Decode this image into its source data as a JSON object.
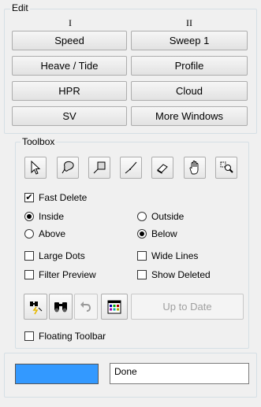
{
  "edit_group": {
    "title": "Edit",
    "col1_header": "I",
    "col2_header": "II",
    "buttons": {
      "speed": "Speed",
      "sweep": "Sweep 1",
      "heave": "Heave / Tide",
      "profile": "Profile",
      "hpr": "HPR",
      "cloud": "Cloud",
      "sv": "SV",
      "more_windows": "More Windows"
    }
  },
  "toolbox": {
    "title": "Toolbox",
    "tools": [
      {
        "icon": "arrow-pointer-icon"
      },
      {
        "icon": "lasso-select-icon"
      },
      {
        "icon": "rectangle-select-icon"
      },
      {
        "icon": "line-select-icon"
      },
      {
        "icon": "eraser-icon"
      },
      {
        "icon": "hand-pan-icon"
      },
      {
        "icon": "zoom-select-icon"
      }
    ],
    "fast_delete": {
      "label": "Fast Delete",
      "checked": true
    },
    "radios": {
      "inside": {
        "label": "Inside",
        "selected": true
      },
      "outside": {
        "label": "Outside",
        "selected": false
      },
      "above": {
        "label": "Above",
        "selected": false
      },
      "below": {
        "label": "Below",
        "selected": true
      }
    },
    "options": {
      "large_dots": {
        "label": "Large Dots",
        "checked": false
      },
      "wide_lines": {
        "label": "Wide Lines",
        "checked": false
      },
      "filter_preview": {
        "label": "Filter Preview",
        "checked": false
      },
      "show_deleted": {
        "label": "Show Deleted",
        "checked": false
      }
    },
    "action_icons": [
      "filter-binoculars-icon",
      "binoculars-icon",
      "undo-icon",
      "color-palette-icon"
    ],
    "up_to_date": "Up to Date",
    "floating_toolbar": {
      "label": "Floating Toolbar",
      "checked": false
    }
  },
  "status": {
    "indicator_color": "#3399ff",
    "text": "Done"
  }
}
